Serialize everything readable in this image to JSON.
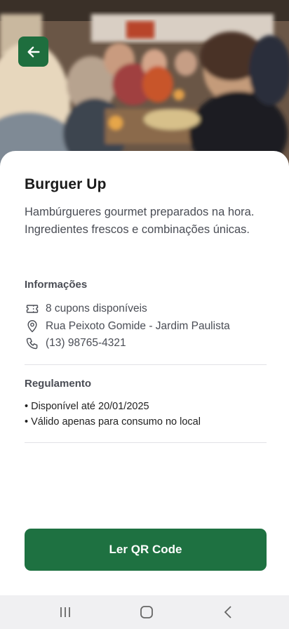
{
  "header": {
    "back_icon": "arrow-left-icon"
  },
  "restaurant": {
    "name": "Burguer Up",
    "description": "Hambúrgueres gourmet preparados na hora. Ingredientes frescos e combinações únicas."
  },
  "info": {
    "title": "Informações",
    "coupons": "8 cupons disponíveis",
    "address": "Rua Peixoto Gomide - Jardim Paulista",
    "phone": "(13) 98765-4321"
  },
  "rules": {
    "title": "Regulamento",
    "items": [
      "• Disponível até 20/01/2025",
      "• Válido apenas para consumo no local"
    ]
  },
  "action": {
    "qr_label": "Ler QR Code"
  },
  "colors": {
    "primary": "#1e7141",
    "text": "#4a4d55"
  }
}
